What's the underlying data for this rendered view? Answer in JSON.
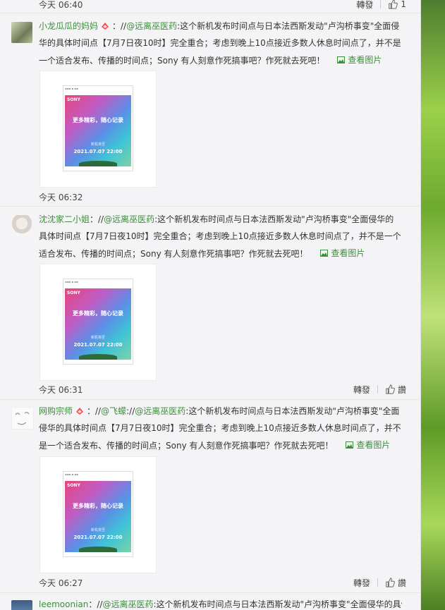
{
  "comments": [
    {
      "time": "今天 06:40",
      "forward": "轉發",
      "likes": "1"
    },
    {
      "user": "小龙瓜瓜的妈妈",
      "prefix": "：//",
      "mentions": [
        "@远离巫医药"
      ],
      "body": ":这个新机发布时间点与日本法西斯发动\"卢沟桥事变\"全面侵华的具体时间点【7月7日夜10时】完全重合；考虑到晚上10点接近多数人休息时间点了，并不是一个适合发布、传播的时间点；Sony 有人刻意作死搞事吧？作死就去死吧！",
      "view_image": "查看图片",
      "time": "今天 06:32"
    },
    {
      "user": "沈沈家二小姐",
      "prefix": "：//",
      "mentions": [
        "@远离巫医药"
      ],
      "body": ":这个新机发布时间点与日本法西斯发动\"卢沟桥事变\"全面侵华的具体时间点【7月7日夜10时】完全重合；考虑到晚上10点接近多数人休息时间点了，并不是一个适合发布、传播的时间点；Sony 有人刻意作死搞事吧？作死就去死吧！",
      "view_image": "查看图片",
      "time": "今天 06:31",
      "forward": "轉發",
      "like_label": "讚"
    },
    {
      "user": "网购宗师",
      "prefix": "：//",
      "mentions": [
        "@飞蠓",
        "@远离巫医药"
      ],
      "mid": "://",
      "body": ":这个新机发布时间点与日本法西斯发动\"卢沟桥事变\"全面侵华的具体时间点【7月7日夜10时】完全重合；考虑到晚上10点接近多数人休息时间点了，并不是一个适合发布、传播的时间点；Sony 有人刻意作死搞事吧？作死就去死吧！",
      "view_image": "查看图片",
      "time": "今天 06:27",
      "forward": "轉發",
      "like_label": "讚"
    },
    {
      "user": "leemoonian",
      "prefix": "：//",
      "mentions": [
        "@远离巫医药"
      ],
      "body": ":这个新机发布时间点与日本法西斯发动\"卢沟桥事变\"全面侵华的具体"
    }
  ],
  "poster": {
    "brand": "SONY",
    "slogan": "更多精彩，随心记录",
    "sub": "新机将至",
    "date": "2021.07.07   22:00"
  },
  "colors": {
    "link_green": "#3a8e3a",
    "bg": "#f4f4f6"
  }
}
